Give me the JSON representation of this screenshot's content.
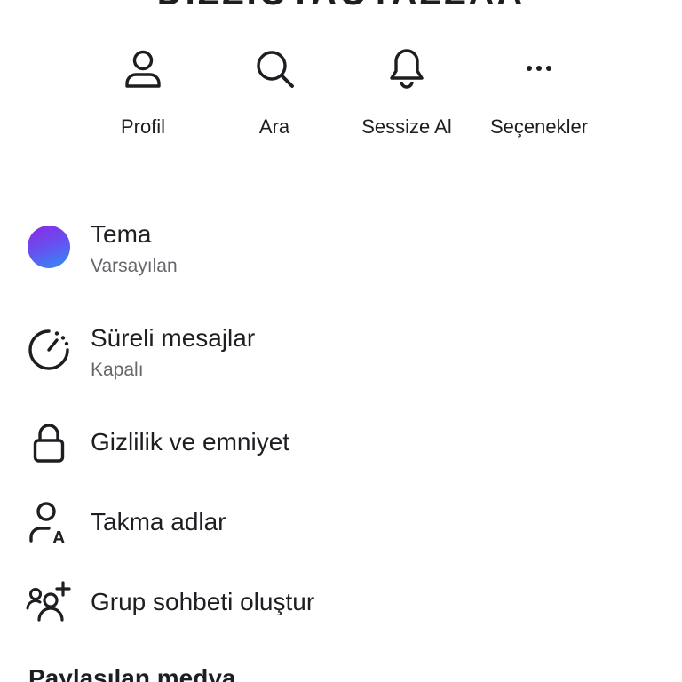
{
  "header": {
    "name": "DIZZIOTAOTAZZAA"
  },
  "actions": [
    {
      "label": "Profil",
      "icon": "person-icon"
    },
    {
      "label": "Ara",
      "icon": "search-icon"
    },
    {
      "label": "Sessize Al",
      "icon": "bell-icon"
    },
    {
      "label": "Seçenekler",
      "icon": "more-icon"
    }
  ],
  "settings": {
    "theme": {
      "title": "Tema",
      "subtitle": "Varsayılan"
    },
    "disappearing": {
      "title": "Süreli mesajlar",
      "subtitle": "Kapalı"
    },
    "privacy": {
      "title": "Gizlilik ve emniyet"
    },
    "nicknames": {
      "title": "Takma adlar"
    },
    "group": {
      "title": "Grup sohbeti oluştur"
    }
  },
  "shared_media": {
    "title": "Paylaşılan medya"
  }
}
